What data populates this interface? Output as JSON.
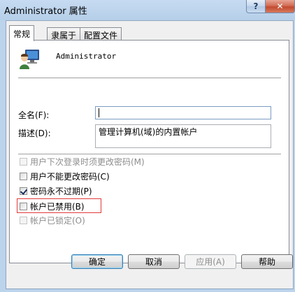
{
  "window": {
    "title": "Administrator 属性",
    "help_label": "?",
    "close_label": "✕"
  },
  "tabs": [
    {
      "label": "常规",
      "active": true
    },
    {
      "label": "隶属于",
      "active": false
    },
    {
      "label": "配置文件",
      "active": false
    }
  ],
  "user": {
    "name": "Administrator",
    "icon": "user-computer-icon"
  },
  "fields": {
    "fullname_label": "全名(F):",
    "fullname_value": "",
    "description_label": "描述(D):",
    "description_value": "管理计算机(域)的内置帐户"
  },
  "options": [
    {
      "label": "用户下次登录时须更改密码(M)",
      "checked": false,
      "disabled": true
    },
    {
      "label": "用户不能更改密码(C)",
      "checked": false,
      "disabled": false
    },
    {
      "label": "密码永不过期(P)",
      "checked": true,
      "disabled": false
    },
    {
      "label": "帐户已禁用(B)",
      "checked": false,
      "disabled": false
    },
    {
      "label": "帐户已锁定(O)",
      "checked": false,
      "disabled": true
    }
  ],
  "buttons": {
    "ok": "确定",
    "cancel": "取消",
    "apply": "应用(A)",
    "help": "帮助"
  },
  "colors": {
    "highlight_border": "#e23a3a",
    "titlebar": "#b9d1ea"
  }
}
